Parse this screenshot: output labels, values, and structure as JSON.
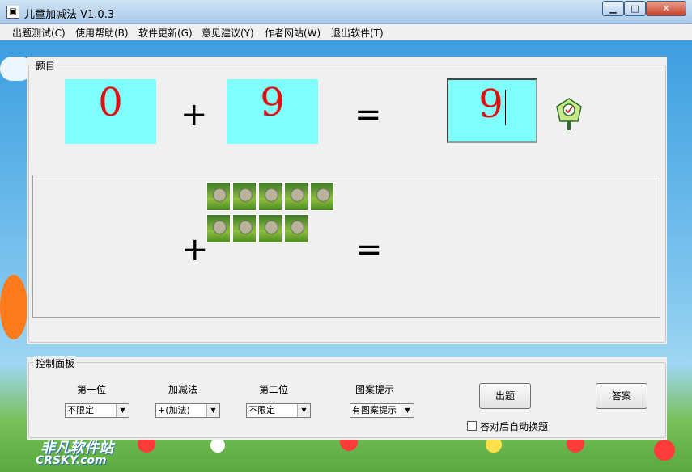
{
  "window": {
    "title": "儿童加减法 V1.0.3",
    "min": "▁",
    "max": "□",
    "close": "✕"
  },
  "menu": [
    "出题测试(C)",
    "使用帮助(B)",
    "软件更新(G)",
    "意见建议(Y)",
    "作者网站(W)",
    "退出软件(T)"
  ],
  "question": {
    "group_label": "题目",
    "first": "0",
    "operator": "+",
    "second": "9",
    "equals": "=",
    "answer": "9"
  },
  "hint": {
    "operator": "+",
    "equals": "=",
    "row1_count": 5,
    "row2_count": 4
  },
  "controls": {
    "group_label": "控制面板",
    "first_digit_label": "第一位",
    "first_digit_value": "不限定",
    "op_label": "加减法",
    "op_value": "+(加法)",
    "second_digit_label": "第二位",
    "second_digit_value": "不限定",
    "pic_hint_label": "图案提示",
    "pic_hint_value": "有图案提示",
    "new_question_button": "出题",
    "answer_button": "答案",
    "auto_next_label": "答对后自动换题"
  },
  "watermark": {
    "cn": "非凡软件站",
    "en": "CRSKY.com"
  }
}
